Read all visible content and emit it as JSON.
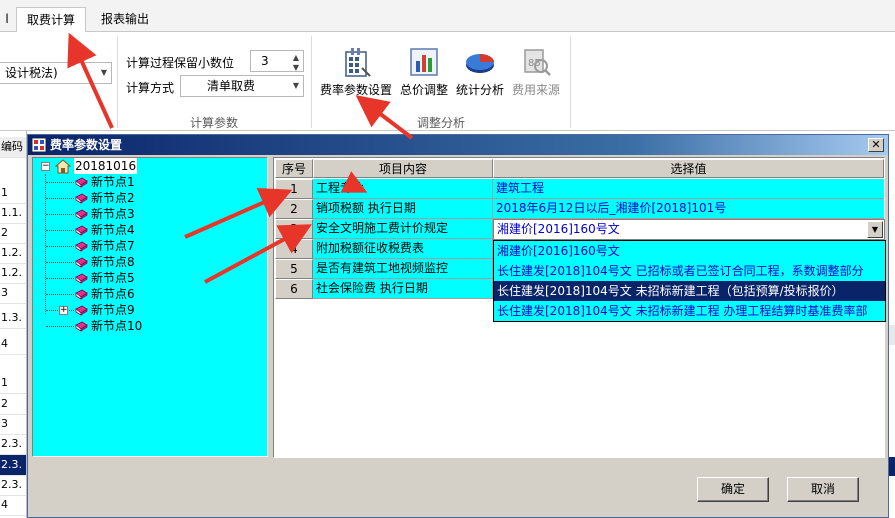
{
  "ribbon": {
    "tabs": [
      {
        "label": "l"
      },
      {
        "label": "取费计算"
      },
      {
        "label": "报表输出"
      }
    ],
    "left_combo_value": "设计税法)",
    "calc": {
      "decimals_label": "计算过程保留小数位",
      "decimals_value": "3",
      "method_label": "计算方式",
      "method_value": "清单取费",
      "group_caption": "计算参数"
    },
    "adjust": {
      "buttons": [
        {
          "label": "费率参数设置",
          "icon": "rate-settings-icon"
        },
        {
          "label": "总价调整",
          "icon": "total-adjust-icon"
        },
        {
          "label": "统计分析",
          "icon": "pie-chart-icon"
        },
        {
          "label": "费用来源",
          "icon": "fee-source-icon"
        }
      ],
      "group_caption": "调整分析"
    }
  },
  "background_column": {
    "header": "编码",
    "cells": [
      "1",
      "1.1.",
      "2",
      "1.2.",
      "1.2.",
      "3",
      "1.3.",
      "4",
      "",
      "1",
      "2",
      "3",
      "2.3.",
      "2.3.",
      "2.3.",
      "4"
    ]
  },
  "dialog": {
    "title": "费率参数设置",
    "tree": {
      "root": "20181016",
      "nodes": [
        "新节点1",
        "新节点2",
        "新节点3",
        "新节点4",
        "新节点7",
        "新节点8",
        "新节点5",
        "新节点6",
        "新节点9",
        "新节点10"
      ]
    },
    "grid": {
      "headers": {
        "num": "序号",
        "item": "项目内容",
        "value": "选择值"
      },
      "rows": [
        {
          "num": "1",
          "item": "工程专业",
          "value": "建筑工程"
        },
        {
          "num": "2",
          "item": "销项税额 执行日期",
          "value": "2018年6月12日以后_湘建价[2018]101号"
        },
        {
          "num": "3",
          "item": "安全文明施工费计价规定",
          "value": "湘建价[2016]160号文"
        },
        {
          "num": "4",
          "item": "附加税额征收税费表",
          "value": ""
        },
        {
          "num": "5",
          "item": "是否有建筑工地视频监控",
          "value": ""
        },
        {
          "num": "6",
          "item": "社会保险费 执行日期",
          "value": ""
        }
      ],
      "editor_value": "湘建价[2016]160号文",
      "dropdown": [
        "湘建价[2016]160号文",
        "长住建发[2018]104号文 已招标或者已签订合同工程，系数调整部分",
        "长住建发[2018]104号文 未招标新建工程（包括预算/投标报价）",
        "长住建发[2018]104号文 未招标新建工程 办理工程结算时基准费率部"
      ],
      "dropdown_selected_index": 2
    },
    "ok_label": "确定",
    "cancel_label": "取消"
  },
  "colors": {
    "cyan": "#00ffff",
    "title_bar": "#0a246a",
    "value_text": "#0000cc",
    "arrow_red": "#e8352a"
  }
}
